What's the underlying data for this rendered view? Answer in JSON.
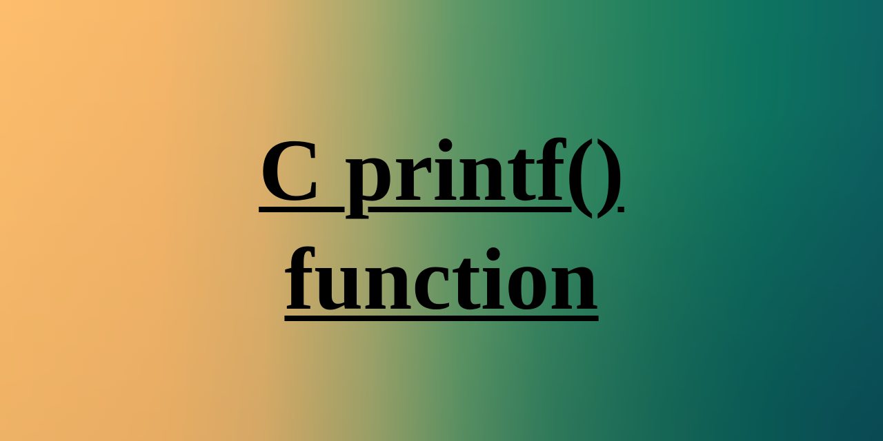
{
  "banner": {
    "title_line1": "C printf()",
    "title_line2": "function",
    "text_color": "#000000",
    "gradient_colors": [
      "#fdbd6c",
      "#3a8b62",
      "#0d6362"
    ]
  }
}
